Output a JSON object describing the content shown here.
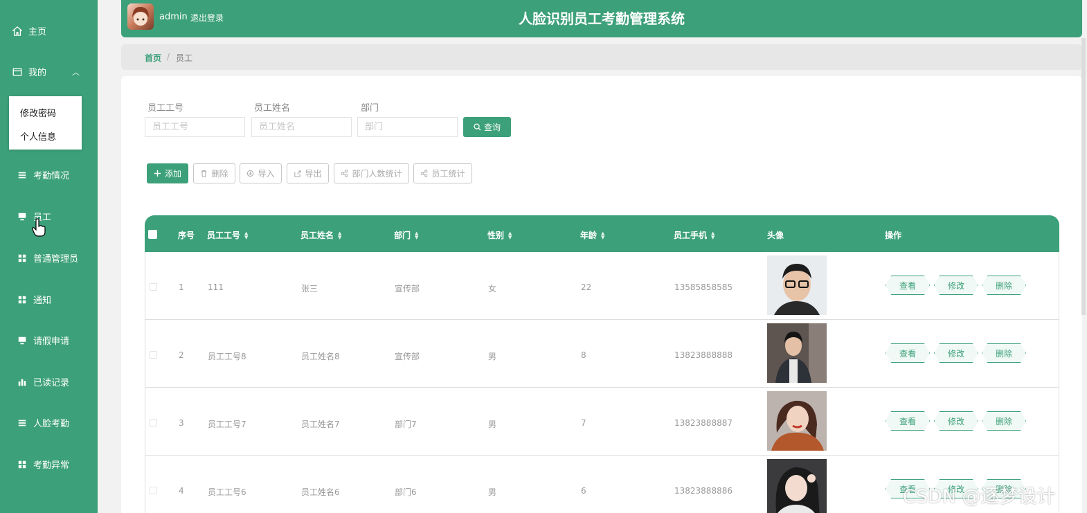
{
  "sidebar": {
    "home": "主页",
    "mine": "我的",
    "submenu": [
      "修改密码",
      "个人信息"
    ],
    "items": [
      "考勤情况",
      "员工",
      "普通管理员",
      "通知",
      "请假申请",
      "已读记录",
      "人脸考勤",
      "考勤异常"
    ]
  },
  "header": {
    "user": "admin",
    "logout": "退出登录",
    "title": "人脸识别员工考勤管理系统"
  },
  "breadcrumb": {
    "home": "首页",
    "sep": "/",
    "current": "员工"
  },
  "search": {
    "fields": [
      {
        "label": "员工工号",
        "placeholder": "员工工号"
      },
      {
        "label": "员工姓名",
        "placeholder": "员工姓名"
      },
      {
        "label": "部门",
        "placeholder": "部门"
      }
    ],
    "button": "查询"
  },
  "toolbar": {
    "add": "添加",
    "delete": "删除",
    "import": "导入",
    "export": "导出",
    "dept_stats": "部门人数统计",
    "emp_stats": "员工统计"
  },
  "table": {
    "headers": {
      "index": "序号",
      "emp_no": "员工工号",
      "name": "员工姓名",
      "dept": "部门",
      "gender": "性别",
      "age": "年龄",
      "phone": "员工手机",
      "avatar": "头像",
      "actions": "操作"
    },
    "rows": [
      {
        "index": "1",
        "emp_no": "111",
        "name": "张三",
        "dept": "宣传部",
        "gender": "女",
        "age": "22",
        "phone": "13585858585"
      },
      {
        "index": "2",
        "emp_no": "员工工号8",
        "name": "员工姓名8",
        "dept": "宣传部",
        "gender": "男",
        "age": "8",
        "phone": "13823888888"
      },
      {
        "index": "3",
        "emp_no": "员工工号7",
        "name": "员工姓名7",
        "dept": "部门7",
        "gender": "男",
        "age": "7",
        "phone": "13823888887"
      },
      {
        "index": "4",
        "emp_no": "员工工号6",
        "name": "员工姓名6",
        "dept": "部门6",
        "gender": "男",
        "age": "6",
        "phone": "13823888886"
      }
    ],
    "actions": {
      "view": "查看",
      "edit": "修改",
      "delete": "删除"
    }
  },
  "watermark": "CSDN @逐梦设计",
  "colors": {
    "primary": "#3ca07a"
  }
}
